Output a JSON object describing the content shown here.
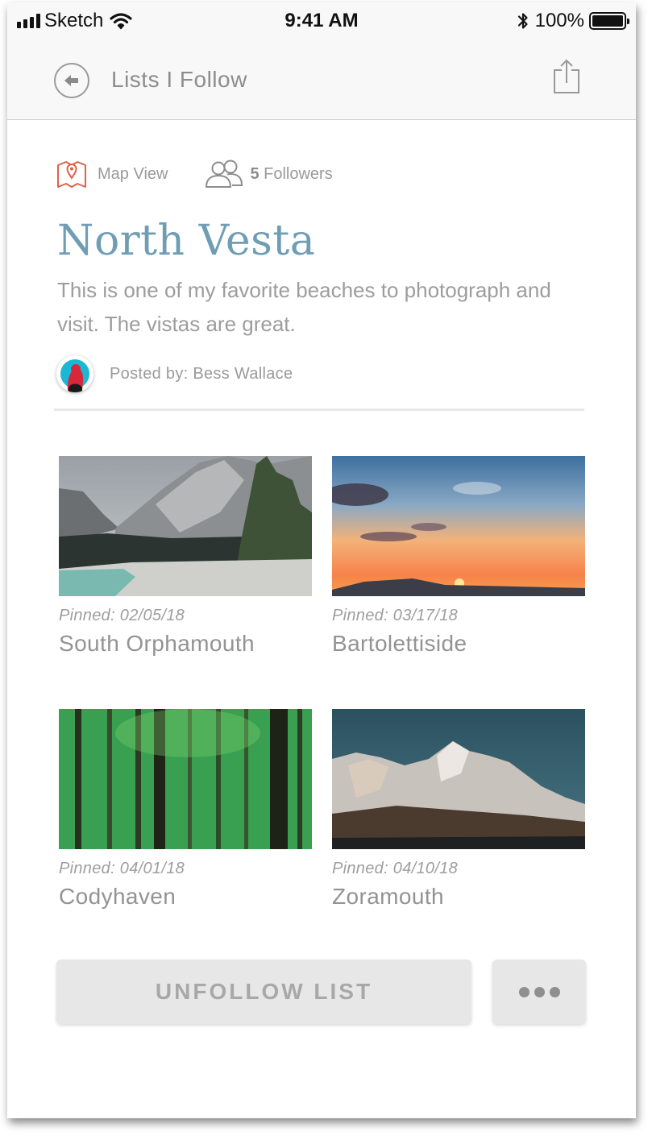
{
  "status_bar": {
    "carrier": "Sketch",
    "time": "9:41 AM",
    "battery": "100%",
    "icons": [
      "signal-bars-icon",
      "wifi-icon",
      "bluetooth-icon",
      "battery-icon"
    ]
  },
  "nav": {
    "title": "Lists I Follow",
    "back_icon": "back-arrow-icon",
    "share_icon": "share-icon"
  },
  "meta": {
    "map_view": "Map View",
    "followers_count": "5",
    "followers_label": "Followers",
    "map_icon_color": "#e0614a"
  },
  "list": {
    "title": "North Vesta",
    "description": "This is one of my favorite beaches to photograph and visit. The vistas are great.",
    "posted_by": "Posted by: Bess Wallace"
  },
  "places": [
    {
      "pinned": "Pinned: 02/05/18",
      "name": "South Orphamouth",
      "image": "mountain-lake-photo"
    },
    {
      "pinned": "Pinned: 03/17/18",
      "name": "Bartolettiside",
      "image": "sunset-photo"
    },
    {
      "pinned": "Pinned: 04/01/18",
      "name": "Codyhaven",
      "image": "forest-photo"
    },
    {
      "pinned": "Pinned: 04/10/18",
      "name": "Zoramouth",
      "image": "snowy-mountain-photo"
    }
  ],
  "actions": {
    "unfollow": "UNFOLLOW LIST",
    "more_icon": "more-dots-icon"
  },
  "colors": {
    "title": "#6f9db3",
    "accent_icon": "#e0614a",
    "button_bg": "#e7e7e7"
  }
}
